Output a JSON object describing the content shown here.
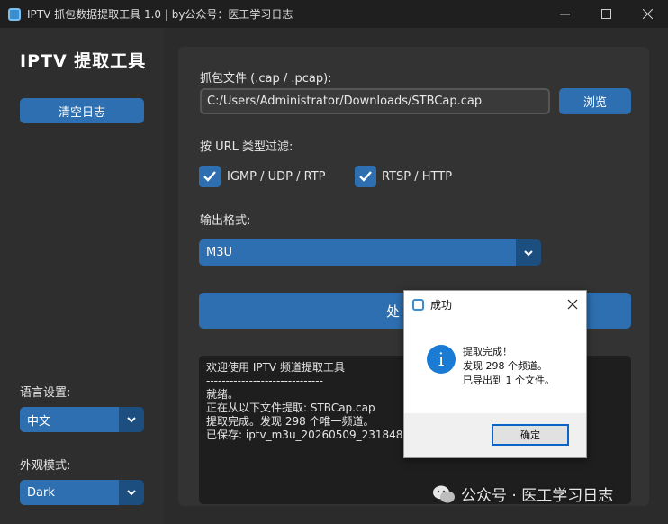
{
  "window": {
    "title": "IPTV 抓包数据提取工具 1.0 | by公众号：医工学习日志"
  },
  "sidebar": {
    "brand": "IPTV 提取工具",
    "clear_log_label": "清空日志",
    "language_label": "语言设置:",
    "language_value": "中文",
    "appearance_label": "外观模式:",
    "appearance_value": "Dark"
  },
  "main": {
    "file_label": "抓包文件 (.cap / .pcap):",
    "file_path": "C:/Users/Administrator/Downloads/STBCap.cap",
    "browse_label": "浏览",
    "filter_label": "按 URL 类型过滤:",
    "filters": [
      {
        "label": "IGMP / UDP / RTP",
        "checked": true
      },
      {
        "label": "RTSP / HTTP",
        "checked": true
      }
    ],
    "format_label": "输出格式:",
    "format_value": "M3U",
    "process_label": "处"
  },
  "log": {
    "lines": [
      "欢迎使用 IPTV 频道提取工具",
      "------------------------------",
      "就绪。",
      "正在从以下文件提取: STBCap.cap",
      "提取完成。发现 298 个唯一频道。",
      "已保存: iptv_m3u_20260509_231848.m"
    ]
  },
  "dialog": {
    "title": "成功",
    "message_lines": [
      "提取完成！",
      "发现 298 个频道。",
      "已导出到 1 个文件。"
    ],
    "ok_label": "确定"
  },
  "watermark": {
    "text": "公众号 · 医工学习日志"
  }
}
